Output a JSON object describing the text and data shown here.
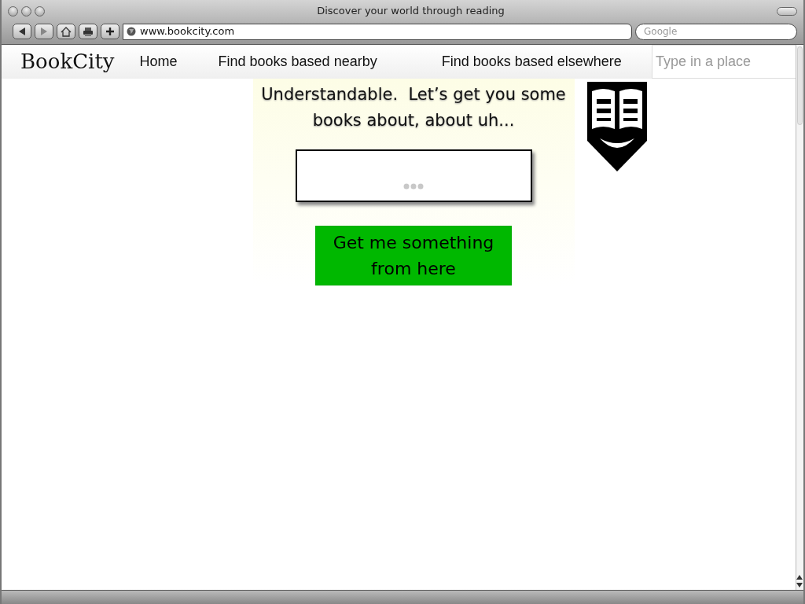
{
  "window": {
    "title": "Discover your world through reading"
  },
  "toolbar": {
    "address": "www.bookcity.com",
    "search_placeholder": "Google"
  },
  "navbar": {
    "brand": "BookCity",
    "links": [
      {
        "label": "Home"
      },
      {
        "label": "Find books based nearby"
      },
      {
        "label": "Find books based elsewhere"
      }
    ],
    "place_field": {
      "placeholder": "Type in a place"
    }
  },
  "main": {
    "prompt": "Understandable.  Let’s get you some books about, about uh...",
    "button": "Get me something from here"
  }
}
